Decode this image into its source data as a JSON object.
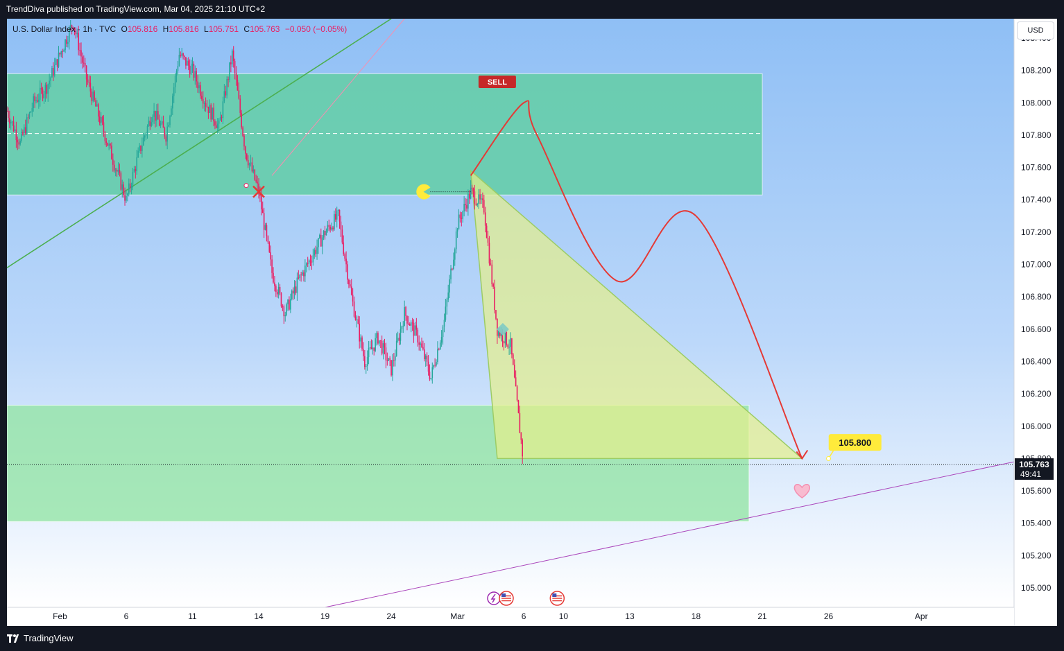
{
  "header": {
    "published_text": "TrendDiva published on TradingView.com, Mar 04, 2025 21:10 UTC+2"
  },
  "legend": {
    "symbol": "U.S. Dollar Index · 1h · TVC",
    "open_label": "O",
    "open": "105.816",
    "high_label": "H",
    "high": "105.816",
    "low_label": "L",
    "low": "105.751",
    "close_label": "C",
    "close": "105.763",
    "change": "−0.050 (−0.05%)"
  },
  "currency_button": "USD",
  "price_badge": {
    "price": "105.763",
    "countdown": "49:41"
  },
  "annotations": {
    "sell_label": "SELL",
    "target_label": "105.800"
  },
  "footer": {
    "brand": "TradingView"
  },
  "colors": {
    "bull": "#26a69a",
    "bear": "#e91e63",
    "sell": "#c62828",
    "path": "#e53935",
    "target_bg": "#ffeb3b",
    "zone_upper": "#66cdaa",
    "zone_lower": "#90e4a0",
    "triangle": "#e6f08a",
    "trend_green": "#4caf50",
    "trend_purple": "#ab47bc"
  },
  "chart_data": {
    "type": "candlestick",
    "ylim": [
      104.88,
      108.52
    ],
    "y_ticks": [
      105.0,
      105.2,
      105.4,
      105.6,
      105.8,
      106.0,
      106.2,
      106.4,
      106.6,
      106.8,
      107.0,
      107.2,
      107.4,
      107.6,
      107.8,
      108.0,
      108.2,
      108.4
    ],
    "y_tick_labels": [
      "105.000",
      "105.200",
      "105.400",
      "105.600",
      "105.800",
      "106.000",
      "106.200",
      "106.400",
      "106.600",
      "106.800",
      "107.000",
      "107.200",
      "107.400",
      "107.600",
      "107.800",
      "108.000",
      "108.200",
      "108.400"
    ],
    "x_range": [
      "2025-01-28",
      "2025-04-14"
    ],
    "x_ticks": [
      {
        "date": "2025-02-01",
        "label": "Feb"
      },
      {
        "date": "2025-02-06",
        "label": "6"
      },
      {
        "date": "2025-02-11",
        "label": "11"
      },
      {
        "date": "2025-02-16",
        "label": "14"
      },
      {
        "date": "2025-02-21",
        "label": "19"
      },
      {
        "date": "2025-02-26",
        "label": "24"
      },
      {
        "date": "2025-03-03",
        "label": "Mar"
      },
      {
        "date": "2025-03-08",
        "label": "6"
      },
      {
        "date": "2025-03-11",
        "label": "10"
      },
      {
        "date": "2025-03-16",
        "label": "13"
      },
      {
        "date": "2025-03-21",
        "label": "18"
      },
      {
        "date": "2025-03-26",
        "label": "21"
      },
      {
        "date": "2025-03-31",
        "label": "26"
      },
      {
        "date": "2025-04-07",
        "label": "Apr"
      }
    ],
    "price_path": [
      [
        "2025-01-28",
        107.95
      ],
      [
        "2025-01-29",
        107.75
      ],
      [
        "2025-01-30",
        108.0
      ],
      [
        "2025-01-31",
        108.1
      ],
      [
        "2025-02-01",
        108.3
      ],
      [
        "2025-02-02",
        108.5
      ],
      [
        "2025-02-03",
        108.15
      ],
      [
        "2025-02-04",
        107.9
      ],
      [
        "2025-02-05",
        107.65
      ],
      [
        "2025-02-06",
        107.4
      ],
      [
        "2025-02-07",
        107.7
      ],
      [
        "2025-02-08",
        107.95
      ],
      [
        "2025-02-09",
        107.8
      ],
      [
        "2025-02-10",
        108.3
      ],
      [
        "2025-02-11",
        108.2
      ],
      [
        "2025-02-12",
        108.0
      ],
      [
        "2025-02-13",
        107.85
      ],
      [
        "2025-02-14",
        108.3
      ],
      [
        "2025-02-15",
        107.7
      ],
      [
        "2025-02-16",
        107.45
      ],
      [
        "2025-02-17",
        106.95
      ],
      [
        "2025-02-18",
        106.7
      ],
      [
        "2025-02-19",
        106.9
      ],
      [
        "2025-02-20",
        107.05
      ],
      [
        "2025-02-21",
        107.2
      ],
      [
        "2025-02-22",
        107.3
      ],
      [
        "2025-02-23",
        106.8
      ],
      [
        "2025-02-24",
        106.4
      ],
      [
        "2025-02-25",
        106.55
      ],
      [
        "2025-02-26",
        106.35
      ],
      [
        "2025-02-27",
        106.7
      ],
      [
        "2025-02-28",
        106.55
      ],
      [
        "2025-03-01",
        106.3
      ],
      [
        "2025-03-02",
        106.65
      ],
      [
        "2025-03-03",
        107.25
      ],
      [
        "2025-03-04",
        107.45
      ],
      [
        "2025-03-05",
        107.35
      ],
      [
        "2025-03-06",
        106.6
      ],
      [
        "2025-03-07",
        106.5
      ],
      [
        "2025-03-08",
        105.76
      ]
    ],
    "zones": [
      {
        "x0": "2025-01-28",
        "x1": "2025-03-26",
        "y0": 107.43,
        "y1": 108.18
      },
      {
        "x0": "2025-01-28",
        "x1": "2025-03-25",
        "y0": 105.41,
        "y1": 106.13
      }
    ],
    "dashed_level": 107.81,
    "last_price": 105.763,
    "projection": {
      "arc": [
        [
          "2025-03-04",
          107.55
        ],
        [
          "2025-03-08",
          108.0
        ],
        [
          "2025-03-09",
          107.8
        ],
        [
          "2025-03-15",
          106.9
        ],
        [
          "2025-03-21",
          107.3
        ],
        [
          "2025-03-29",
          105.8
        ]
      ],
      "target": {
        "date": "2025-03-31",
        "value": 105.8
      }
    },
    "triangle": [
      [
        "2025-03-04",
        107.58
      ],
      [
        "2025-03-06",
        105.8
      ],
      [
        "2025-03-29",
        105.8
      ]
    ],
    "trendlines": [
      {
        "from": [
          "2025-01-28",
          106.98
        ],
        "to": [
          "2025-02-26",
          108.52
        ]
      },
      {
        "from": [
          "2025-02-21",
          104.88
        ],
        "to": [
          "2025-04-14",
          105.78
        ]
      }
    ]
  }
}
